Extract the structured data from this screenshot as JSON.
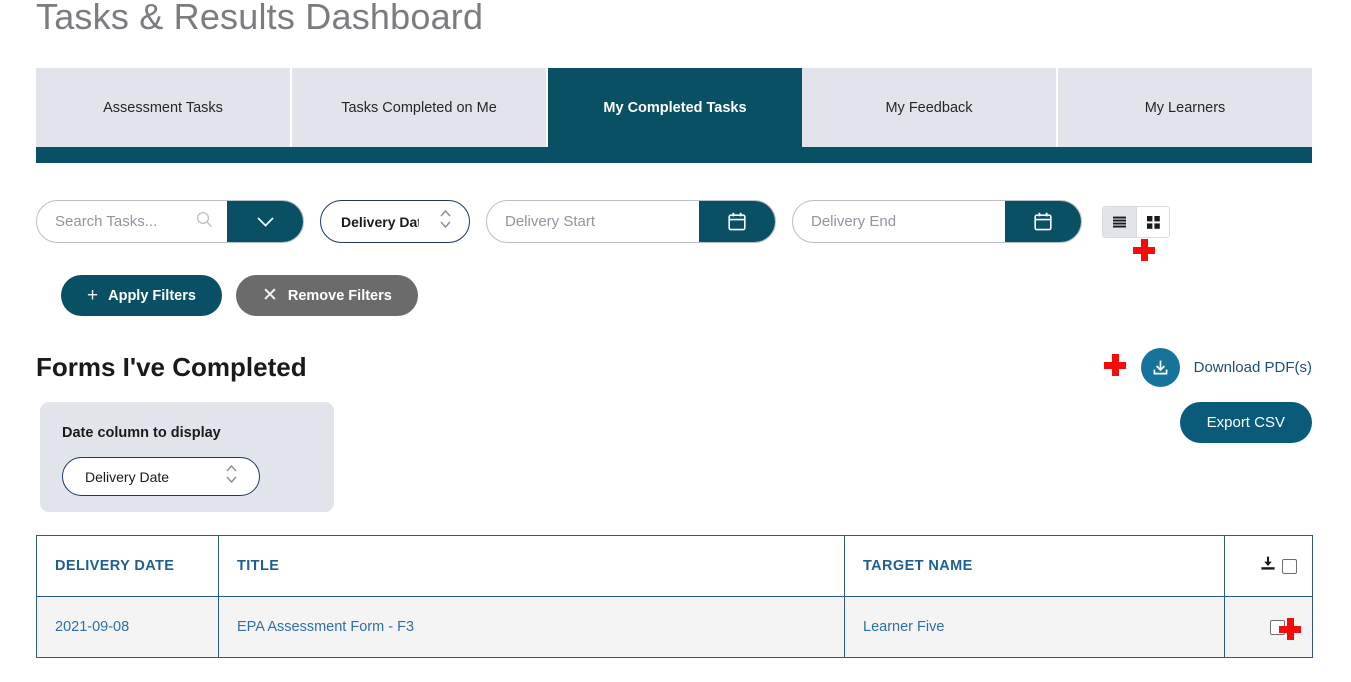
{
  "header": {
    "title": "Tasks & Results Dashboard"
  },
  "theme": {
    "teal": "#0a5064",
    "tab_inactive_bg": "#e1e5eb",
    "link_blue": "#2f6fa8",
    "header_blue": "#1f6090",
    "marker_red": "#f60b0b",
    "card_bg": "#e1e5eb",
    "row_bg": "#f4f4f4"
  },
  "tabs": [
    {
      "label": "Assessment Tasks",
      "active": false
    },
    {
      "label": "Tasks Completed on Me",
      "active": false
    },
    {
      "label": "My Completed Tasks",
      "active": true
    },
    {
      "label": "My Feedback",
      "active": false
    },
    {
      "label": "My Learners",
      "active": false
    }
  ],
  "filters": {
    "search": {
      "placeholder": "Search Tasks...",
      "value": "",
      "icon": "search-icon",
      "dropdown_icon": "chevron-down-icon"
    },
    "sort_select": {
      "value": "Delivery Date",
      "stepper_icon": "stepper-updown-icon"
    },
    "delivery_start": {
      "placeholder": "Delivery Start",
      "value": "",
      "icon": "calendar-icon"
    },
    "delivery_end": {
      "placeholder": "Delivery End",
      "value": "",
      "icon": "calendar-icon"
    },
    "view_toggle": {
      "list": {
        "icon": "list-view-icon",
        "active": true
      },
      "grid": {
        "icon": "grid-view-icon",
        "active": false
      }
    },
    "apply_button": {
      "label": "Apply Filters",
      "icon": "plus-icon"
    },
    "remove_button": {
      "label": "Remove Filters",
      "icon": "close-x-icon"
    }
  },
  "section": {
    "title": "Forms I've Completed",
    "date_column_card": {
      "label": "Date column to display",
      "select_value": "Delivery Date",
      "stepper_icon": "stepper-updown-icon"
    },
    "download_pdf": {
      "label": "Download PDF(s)",
      "icon": "download-icon"
    },
    "export_csv": {
      "label": "Export CSV"
    }
  },
  "table": {
    "columns": [
      "DELIVERY DATE",
      "TITLE",
      "TARGET NAME",
      ""
    ],
    "actions_header_icon": "download-tray-icon",
    "rows": [
      {
        "delivery_date": "2021-09-08",
        "title": "EPA Assessment Form - F3",
        "target_name": "Learner Five",
        "selected": false
      }
    ]
  }
}
